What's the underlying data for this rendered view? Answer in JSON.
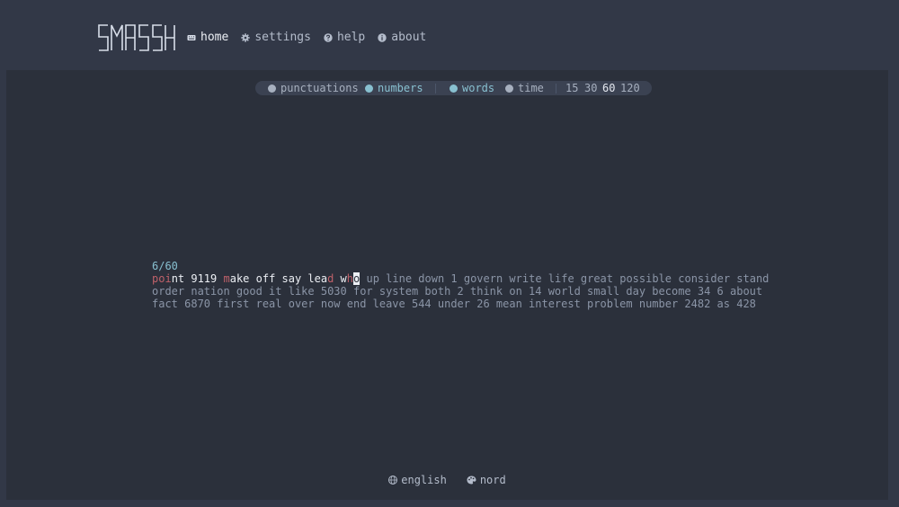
{
  "app": {
    "logo_text": "SMASSH"
  },
  "nav": {
    "home": "home",
    "settings": "settings",
    "help": "help",
    "about": "about"
  },
  "config": {
    "punctuations": "punctuations",
    "numbers": "numbers",
    "words": "words",
    "time": "time",
    "counts": [
      "15",
      "30",
      "60",
      "120"
    ],
    "selected_count": "60"
  },
  "test": {
    "progress": "6/60",
    "line1_rest": " up line down 1 govern write life great possible consider stand",
    "line2": "order nation good it like 5030 for system both 2 think on 14 world small day become 34 6 about",
    "line3": "fact 6870 first real over now end leave 544 under 26 mean interest problem number 2482 as 428"
  },
  "footer": {
    "language": "english",
    "theme": "nord"
  },
  "colors": {
    "background": "#323847",
    "panel": "#2b303b",
    "accent": "#88c0d0",
    "error": "#bf616a",
    "text": "#eceff4"
  }
}
